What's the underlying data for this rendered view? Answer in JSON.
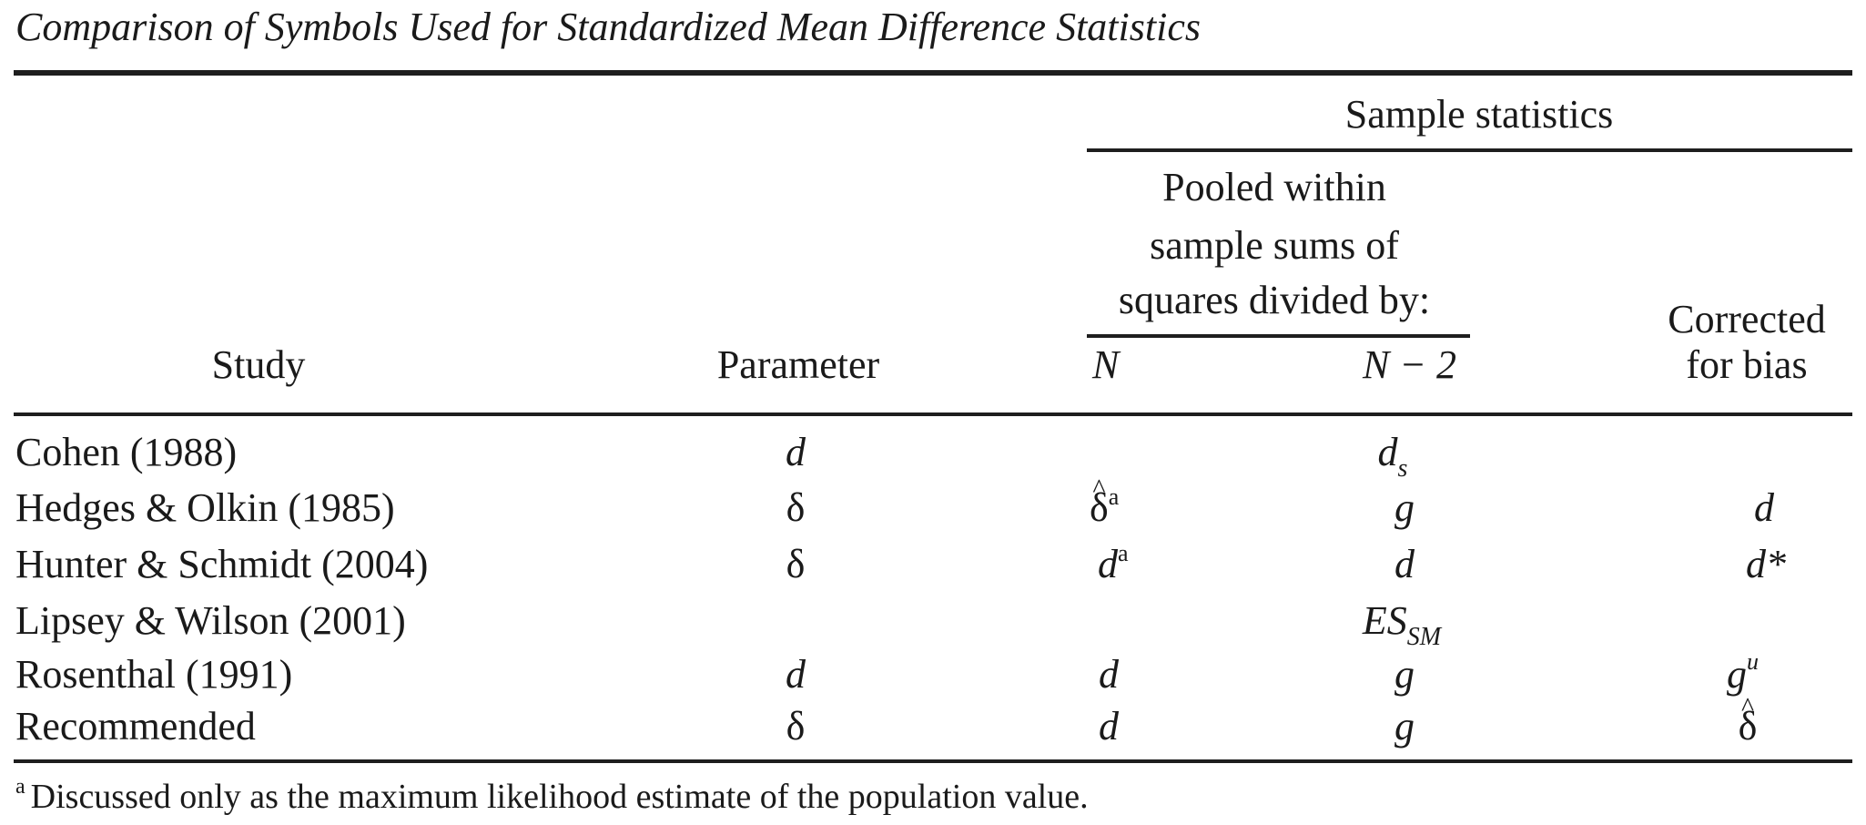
{
  "table": {
    "title": "Comparison of Symbols Used for Standardized Mean Difference Statistics",
    "headers": {
      "study": "Study",
      "parameter": "Parameter",
      "sample_statistics": "Sample statistics",
      "pooled_lines": [
        "Pooled within",
        "sample sums of",
        "squares divided by:"
      ],
      "n": "N",
      "n_minus_2": "N − 2",
      "corrected_lines": [
        "Corrected",
        "for bias"
      ]
    },
    "rows": [
      {
        "study": "Cohen (1988)",
        "parameter": "d",
        "n": "",
        "n_minus_2": "d",
        "n_minus_2_sub": "s",
        "corrected": "",
        "spanning": true
      },
      {
        "study": "Hedges & Olkin (1985)",
        "parameter": "δ",
        "n": "δ",
        "n_hat": true,
        "n_sup": "a",
        "n_minus_2": "g",
        "corrected": "d"
      },
      {
        "study": "Hunter & Schmidt (2004)",
        "parameter": "δ",
        "n": "d",
        "n_sup": "a",
        "n_minus_2": "d",
        "corrected": "d*"
      },
      {
        "study": "Lipsey & Wilson (2001)",
        "parameter": "",
        "n": "",
        "n_minus_2": "ES",
        "n_minus_2_sub": "SM",
        "corrected": "",
        "spanning": true
      },
      {
        "study": "Rosenthal (1991)",
        "parameter": "d",
        "n": "d",
        "n_minus_2": "g",
        "corrected": "g",
        "corrected_sup": "u"
      },
      {
        "study": "Recommended",
        "parameter": "δ",
        "n": "d",
        "n_minus_2": "g",
        "corrected": "δ",
        "corrected_hat": true
      }
    ],
    "footnote": {
      "marker": "a",
      "text": "Discussed only as the maximum likelihood estimate of the population value."
    }
  }
}
